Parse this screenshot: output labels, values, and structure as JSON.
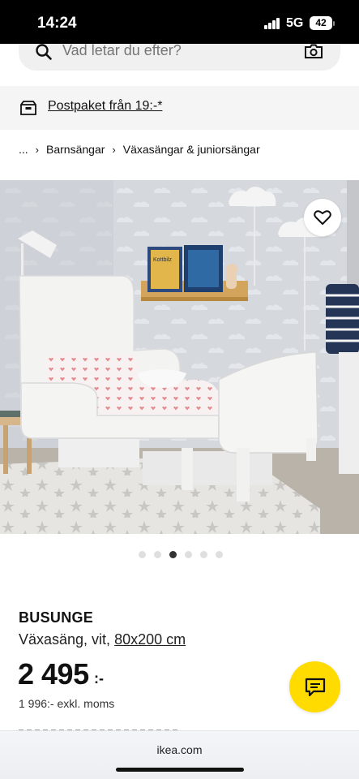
{
  "status_bar": {
    "time": "14:24",
    "network": "5G",
    "battery": "42"
  },
  "search": {
    "placeholder": "Vad letar du efter?"
  },
  "promo": {
    "text": "Postpaket från 19:-*"
  },
  "breadcrumb": {
    "ellipsis": "...",
    "items": [
      "Barnsängar",
      "Växasängar & juniorsängar"
    ]
  },
  "image_scene": {
    "book_1": "Kottbilz"
  },
  "carousel": {
    "total": 6,
    "active_index": 2
  },
  "product": {
    "name": "BUSUNGE",
    "description": "Växasäng, vit,",
    "size": "80x200 cm",
    "price": "2 495",
    "price_suffix": ":-",
    "price_ex_vat": "1 996:- exkl. moms"
  },
  "browser": {
    "domain": "ikea.com"
  },
  "colors": {
    "ikea_yellow": "#ffdb00",
    "status_bar": "#000000",
    "promo_background": "#f5f5f5"
  },
  "icons": {
    "search": "search-icon",
    "camera": "camera-icon",
    "package": "package-icon",
    "favorite": "heart-icon",
    "chat": "chat-icon"
  }
}
